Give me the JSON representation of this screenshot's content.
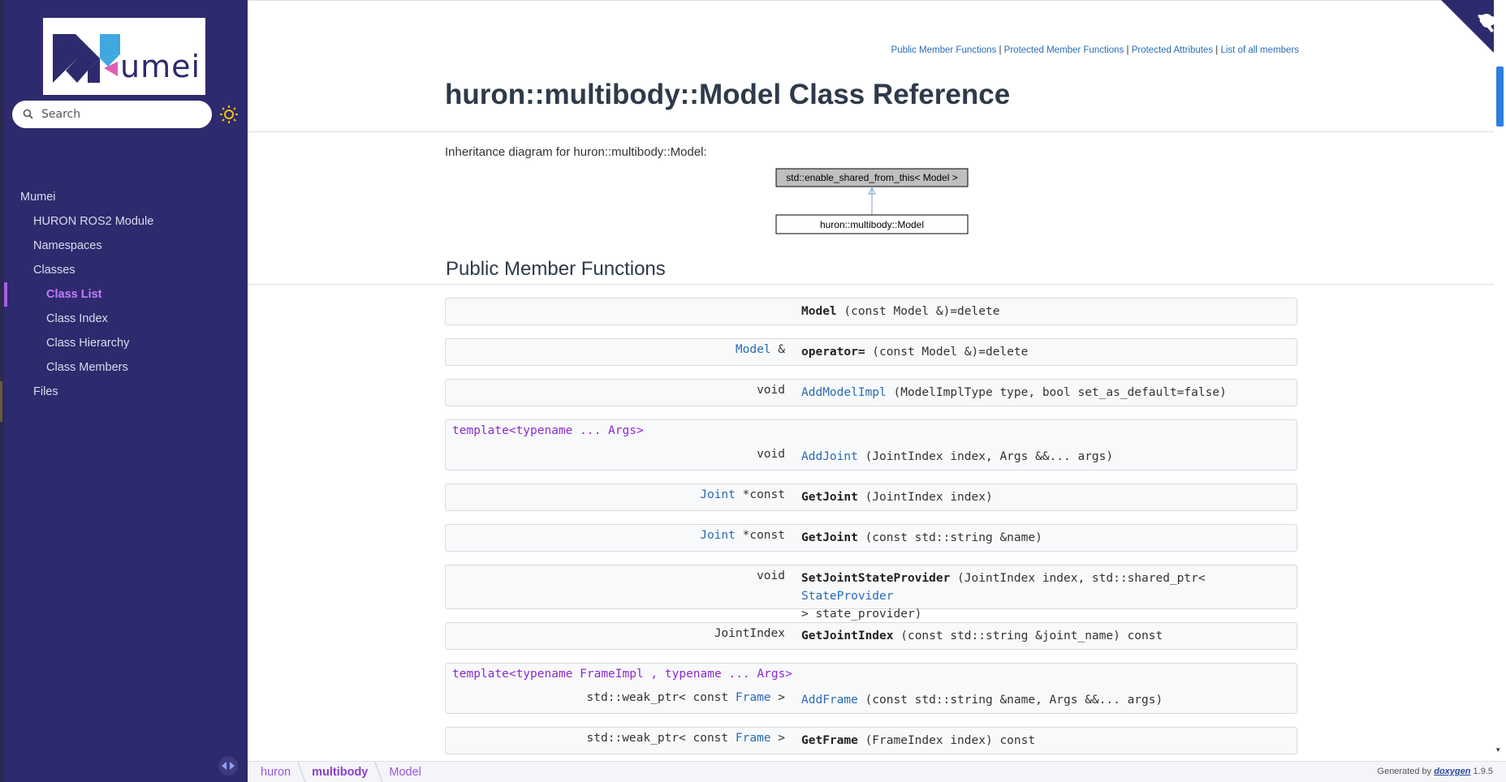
{
  "sidebar": {
    "logo_text": "umei",
    "search_placeholder": "Search",
    "nav": [
      {
        "label": "Mumei"
      },
      {
        "label": "HURON ROS2 Module"
      },
      {
        "label": "Namespaces"
      },
      {
        "label": "Classes"
      },
      {
        "label": "Class List"
      },
      {
        "label": "Class Index"
      },
      {
        "label": "Class Hierarchy"
      },
      {
        "label": "Class Members"
      },
      {
        "label": "Files"
      }
    ]
  },
  "header": {
    "links": [
      "Public Member Functions",
      "Protected Member Functions",
      "Protected Attributes",
      "List of all members"
    ],
    "separator": " | ",
    "title": "huron::multibody::Model Class Reference"
  },
  "inheritance": {
    "label": "Inheritance diagram for huron::multibody::Model:",
    "base": "std::enable_shared_from_this< Model >",
    "derived": "huron::multibody::Model"
  },
  "section": {
    "title": "Public Member Functions"
  },
  "members": [
    {
      "tpl": "",
      "ret": "",
      "ret_link": "",
      "name": "Model",
      "name_link": false,
      "args": " (const Model &)=delete"
    },
    {
      "tpl": "",
      "ret": " &",
      "ret_link": "Model",
      "name": "operator=",
      "name_link": false,
      "args": " (const Model &)=delete"
    },
    {
      "tpl": "",
      "ret": "void",
      "ret_link": "",
      "name": "AddModelImpl",
      "name_link": true,
      "args": " (ModelImplType type, bool set_as_default=false)"
    },
    {
      "tpl": "template<typename ... Args>",
      "ret": "void",
      "ret_link": "",
      "name": "AddJoint",
      "name_link": true,
      "args": " (JointIndex index, Args &&... args)"
    },
    {
      "tpl": "",
      "ret": " *const",
      "ret_link": "Joint",
      "name": "GetJoint",
      "name_link": false,
      "args": " (JointIndex index)"
    },
    {
      "tpl": "",
      "ret": " *const",
      "ret_link": "Joint",
      "name": "GetJoint",
      "name_link": false,
      "args": " (const std::string &name)"
    },
    {
      "tpl": "",
      "ret": "void",
      "ret_link": "",
      "name": "SetJointStateProvider",
      "name_link": false,
      "args_pre": " (JointIndex index, std::shared_ptr< ",
      "args_link": "StateProvider",
      "args_post": "\n> state_provider)"
    },
    {
      "tpl": "",
      "ret": "JointIndex",
      "ret_link": "",
      "name": "GetJointIndex",
      "name_link": false,
      "args": " (const std::string &joint_name) const"
    },
    {
      "tpl": "template<typename FrameImpl , typename ... Args>",
      "ret_pre": "std::weak_ptr< const ",
      "ret_link": "Frame",
      "ret": " >",
      "name": "AddFrame",
      "name_link": true,
      "args": " (const std::string &name, Args &&... args)"
    },
    {
      "tpl": "",
      "ret_pre": "std::weak_ptr< const ",
      "ret_link": "Frame",
      "ret": " >",
      "name": "GetFrame",
      "name_link": false,
      "args": " (FrameIndex index) const"
    }
  ],
  "footer": {
    "crumbs": [
      "huron",
      "multibody",
      "Model"
    ],
    "generated_by": "Generated by",
    "tool": "doxygen",
    "version": "1.9.5"
  },
  "colors": {
    "sidebar_bg": "#2d2a6d",
    "accent": "#c77bff",
    "link": "#2a6bb5",
    "template": "#8a2ad0"
  }
}
